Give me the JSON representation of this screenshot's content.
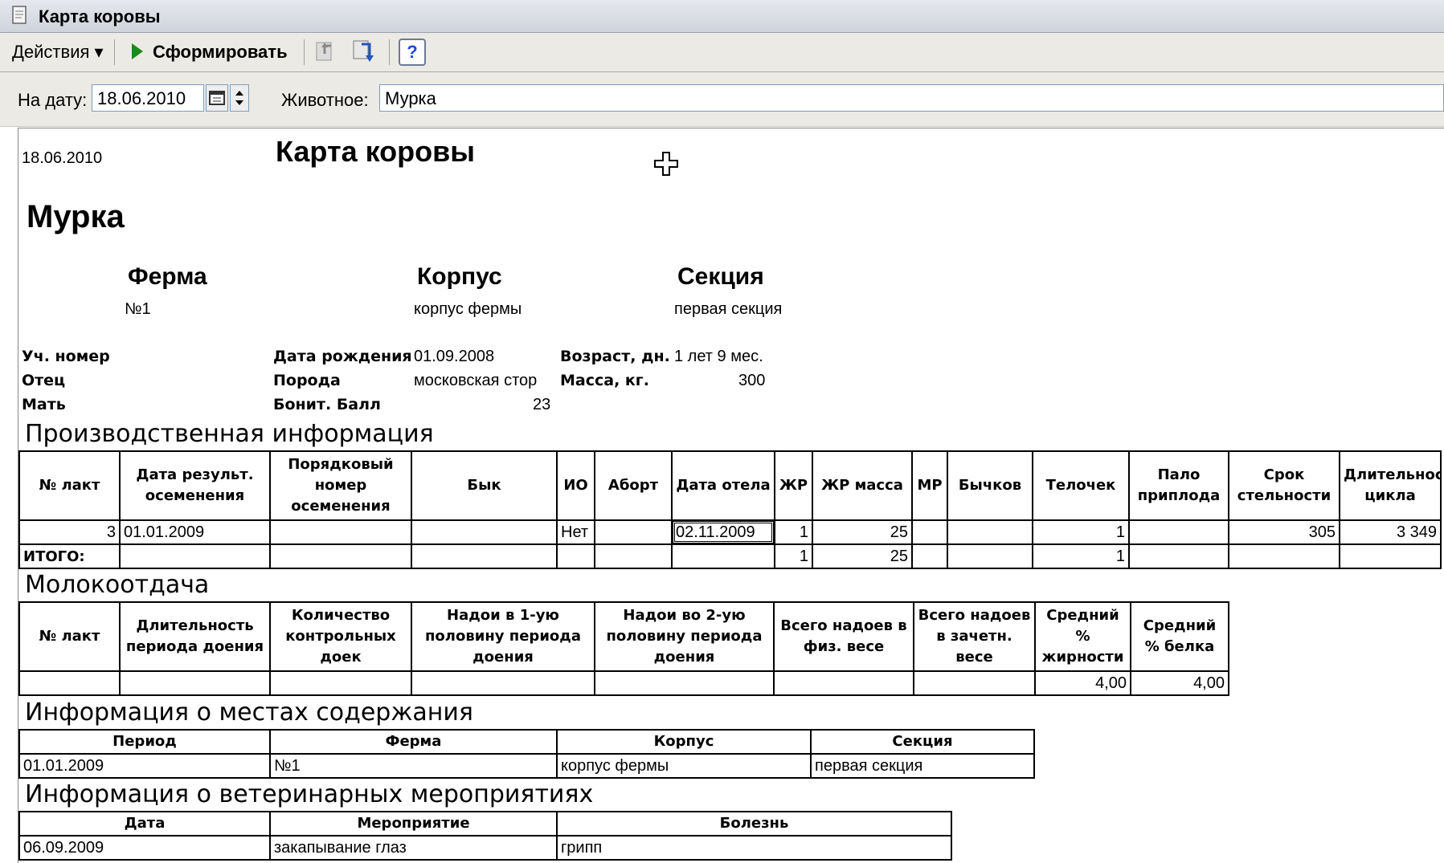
{
  "window": {
    "title": "Карта коровы"
  },
  "toolbar": {
    "actions_label": "Действия ▾",
    "generate_label": "Сформировать",
    "help_label": "?"
  },
  "params": {
    "date_label": "На дату:",
    "date_value": "18.06.2010",
    "animal_label": "Животное:",
    "animal_value": "Мурка"
  },
  "report": {
    "date": "18.06.2010",
    "title": "Карта  коровы",
    "animal": "Мурка",
    "farm_label": "Ферма",
    "farm_value": "№1",
    "building_label": "Корпус",
    "building_value": "корпус фермы",
    "section_label": "Секция",
    "section_value": "первая секция",
    "fields": {
      "reg_no_label": "Уч. номер",
      "father_label": "Отец",
      "mother_label": "Мать",
      "birth_label": "Дата рождения",
      "birth_value": "01.09.2008",
      "breed_label": "Порода",
      "breed_value": "московская стор",
      "score_label": "Бонит. Балл",
      "score_value": "23",
      "age_label": "Возраст, дн.",
      "age_value": "1 лет 9 мес.",
      "mass_label": "Масса, кг.",
      "mass_value": "300"
    },
    "production": {
      "heading": "Производственная информация",
      "headers": [
        "№ лакт",
        "Дата результ. осеменения",
        "Порядковый номер осеменения",
        "Бык",
        "ИО",
        "Аборт",
        "Дата отела",
        "ЖР",
        "ЖР масса",
        "МР",
        "Бычков",
        "Телочек",
        "Пало приплода",
        "Срок стельности",
        "Длительность цикла"
      ],
      "row": [
        "3",
        "01.01.2009",
        "",
        "",
        "Нет",
        "",
        "02.11.2009",
        "1",
        "25",
        "",
        "",
        "1",
        "",
        "305",
        "3 349"
      ],
      "total": [
        "ИТОГО:",
        "",
        "",
        "",
        "",
        "",
        "",
        "1",
        "25",
        "",
        "",
        "1",
        "",
        "",
        ""
      ]
    },
    "milk": {
      "heading": "Молокоотдача",
      "headers": [
        "№ лакт",
        "Длительность периода доения",
        "Количество контрольных доек",
        "Надои в 1-ую половину периода доения",
        "Надои во 2-ую половину периода доения",
        "Всего надоев в физ. весе",
        "Всего надоев в зачетн. весе",
        "Средний % жирности",
        "Средний % белка"
      ],
      "row": [
        "",
        "",
        "",
        "",
        "",
        "",
        "",
        "4,00",
        "4,00"
      ]
    },
    "housing": {
      "heading": "Информация о местах содержания",
      "headers": [
        "Период",
        "Ферма",
        "Корпус",
        "Секция"
      ],
      "row": [
        "01.01.2009",
        "№1",
        "корпус фермы",
        "первая секция"
      ]
    },
    "vet": {
      "heading": "Информация о ветеринарных мероприятиях",
      "headers": [
        "Дата",
        "Мероприятие",
        "Болезнь"
      ],
      "row": [
        "06.09.2009",
        "закапывание глаз",
        "грипп"
      ]
    }
  },
  "colors": {
    "play_green": "#1a8a1a",
    "help_blue": "#1e4ec8"
  }
}
